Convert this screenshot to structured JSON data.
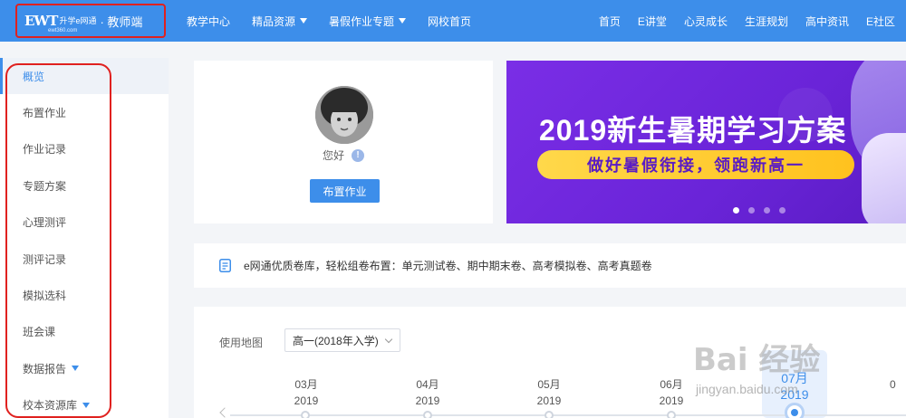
{
  "app": {
    "logo_mark": "EWT",
    "logo_name": "升学e网通",
    "logo_url": "ewt360.com",
    "role": "· 教师端"
  },
  "nav_left": [
    {
      "label": "教学中心",
      "dropdown": false
    },
    {
      "label": "精品资源",
      "dropdown": true
    },
    {
      "label": "暑假作业专题",
      "dropdown": true
    },
    {
      "label": "网校首页",
      "dropdown": false
    }
  ],
  "nav_right": [
    "首页",
    "E讲堂",
    "心灵成长",
    "生涯规划",
    "高中资讯",
    "E社区"
  ],
  "sidebar": {
    "items": [
      {
        "label": "概览",
        "active": true
      },
      {
        "label": "布置作业"
      },
      {
        "label": "作业记录"
      },
      {
        "label": "专题方案"
      },
      {
        "label": "心理测评"
      },
      {
        "label": "测评记录"
      },
      {
        "label": "模拟选科"
      },
      {
        "label": "班会课"
      },
      {
        "label": "数据报告",
        "dropdown": true
      },
      {
        "label": "校本资源库",
        "dropdown": true
      }
    ]
  },
  "profile": {
    "greeting": "您好",
    "info_glyph": "!",
    "assign_button": "布置作业"
  },
  "banner": {
    "title": "2019新生暑期学习方案",
    "subtitle": "做好暑假衔接，领跑新高一",
    "slide_count": 4,
    "active_slide": 0
  },
  "notice": {
    "icon": "document-icon",
    "text": "e网通优质卷库，轻松组卷布置：单元测试卷、期中期末卷、高考模拟卷、高考真题卷"
  },
  "usage_map": {
    "label": "使用地图",
    "select_value": "高一(2018年入学)",
    "timeline": [
      {
        "month": "03月",
        "year": "2019"
      },
      {
        "month": "04月",
        "year": "2019"
      },
      {
        "month": "05月",
        "year": "2019"
      },
      {
        "month": "06月",
        "year": "2019"
      },
      {
        "month": "07月",
        "year": "2019",
        "current": true
      },
      {
        "month": "0",
        "year": ""
      }
    ]
  },
  "watermark": {
    "main": "Bai 经验",
    "sub": "jingyan.baidu.com"
  },
  "colors": {
    "primary": "#3d8eea",
    "annotation_red": "#e0211f",
    "banner_purple": "#6a24d8",
    "banner_yellow": "#ffc21e"
  }
}
